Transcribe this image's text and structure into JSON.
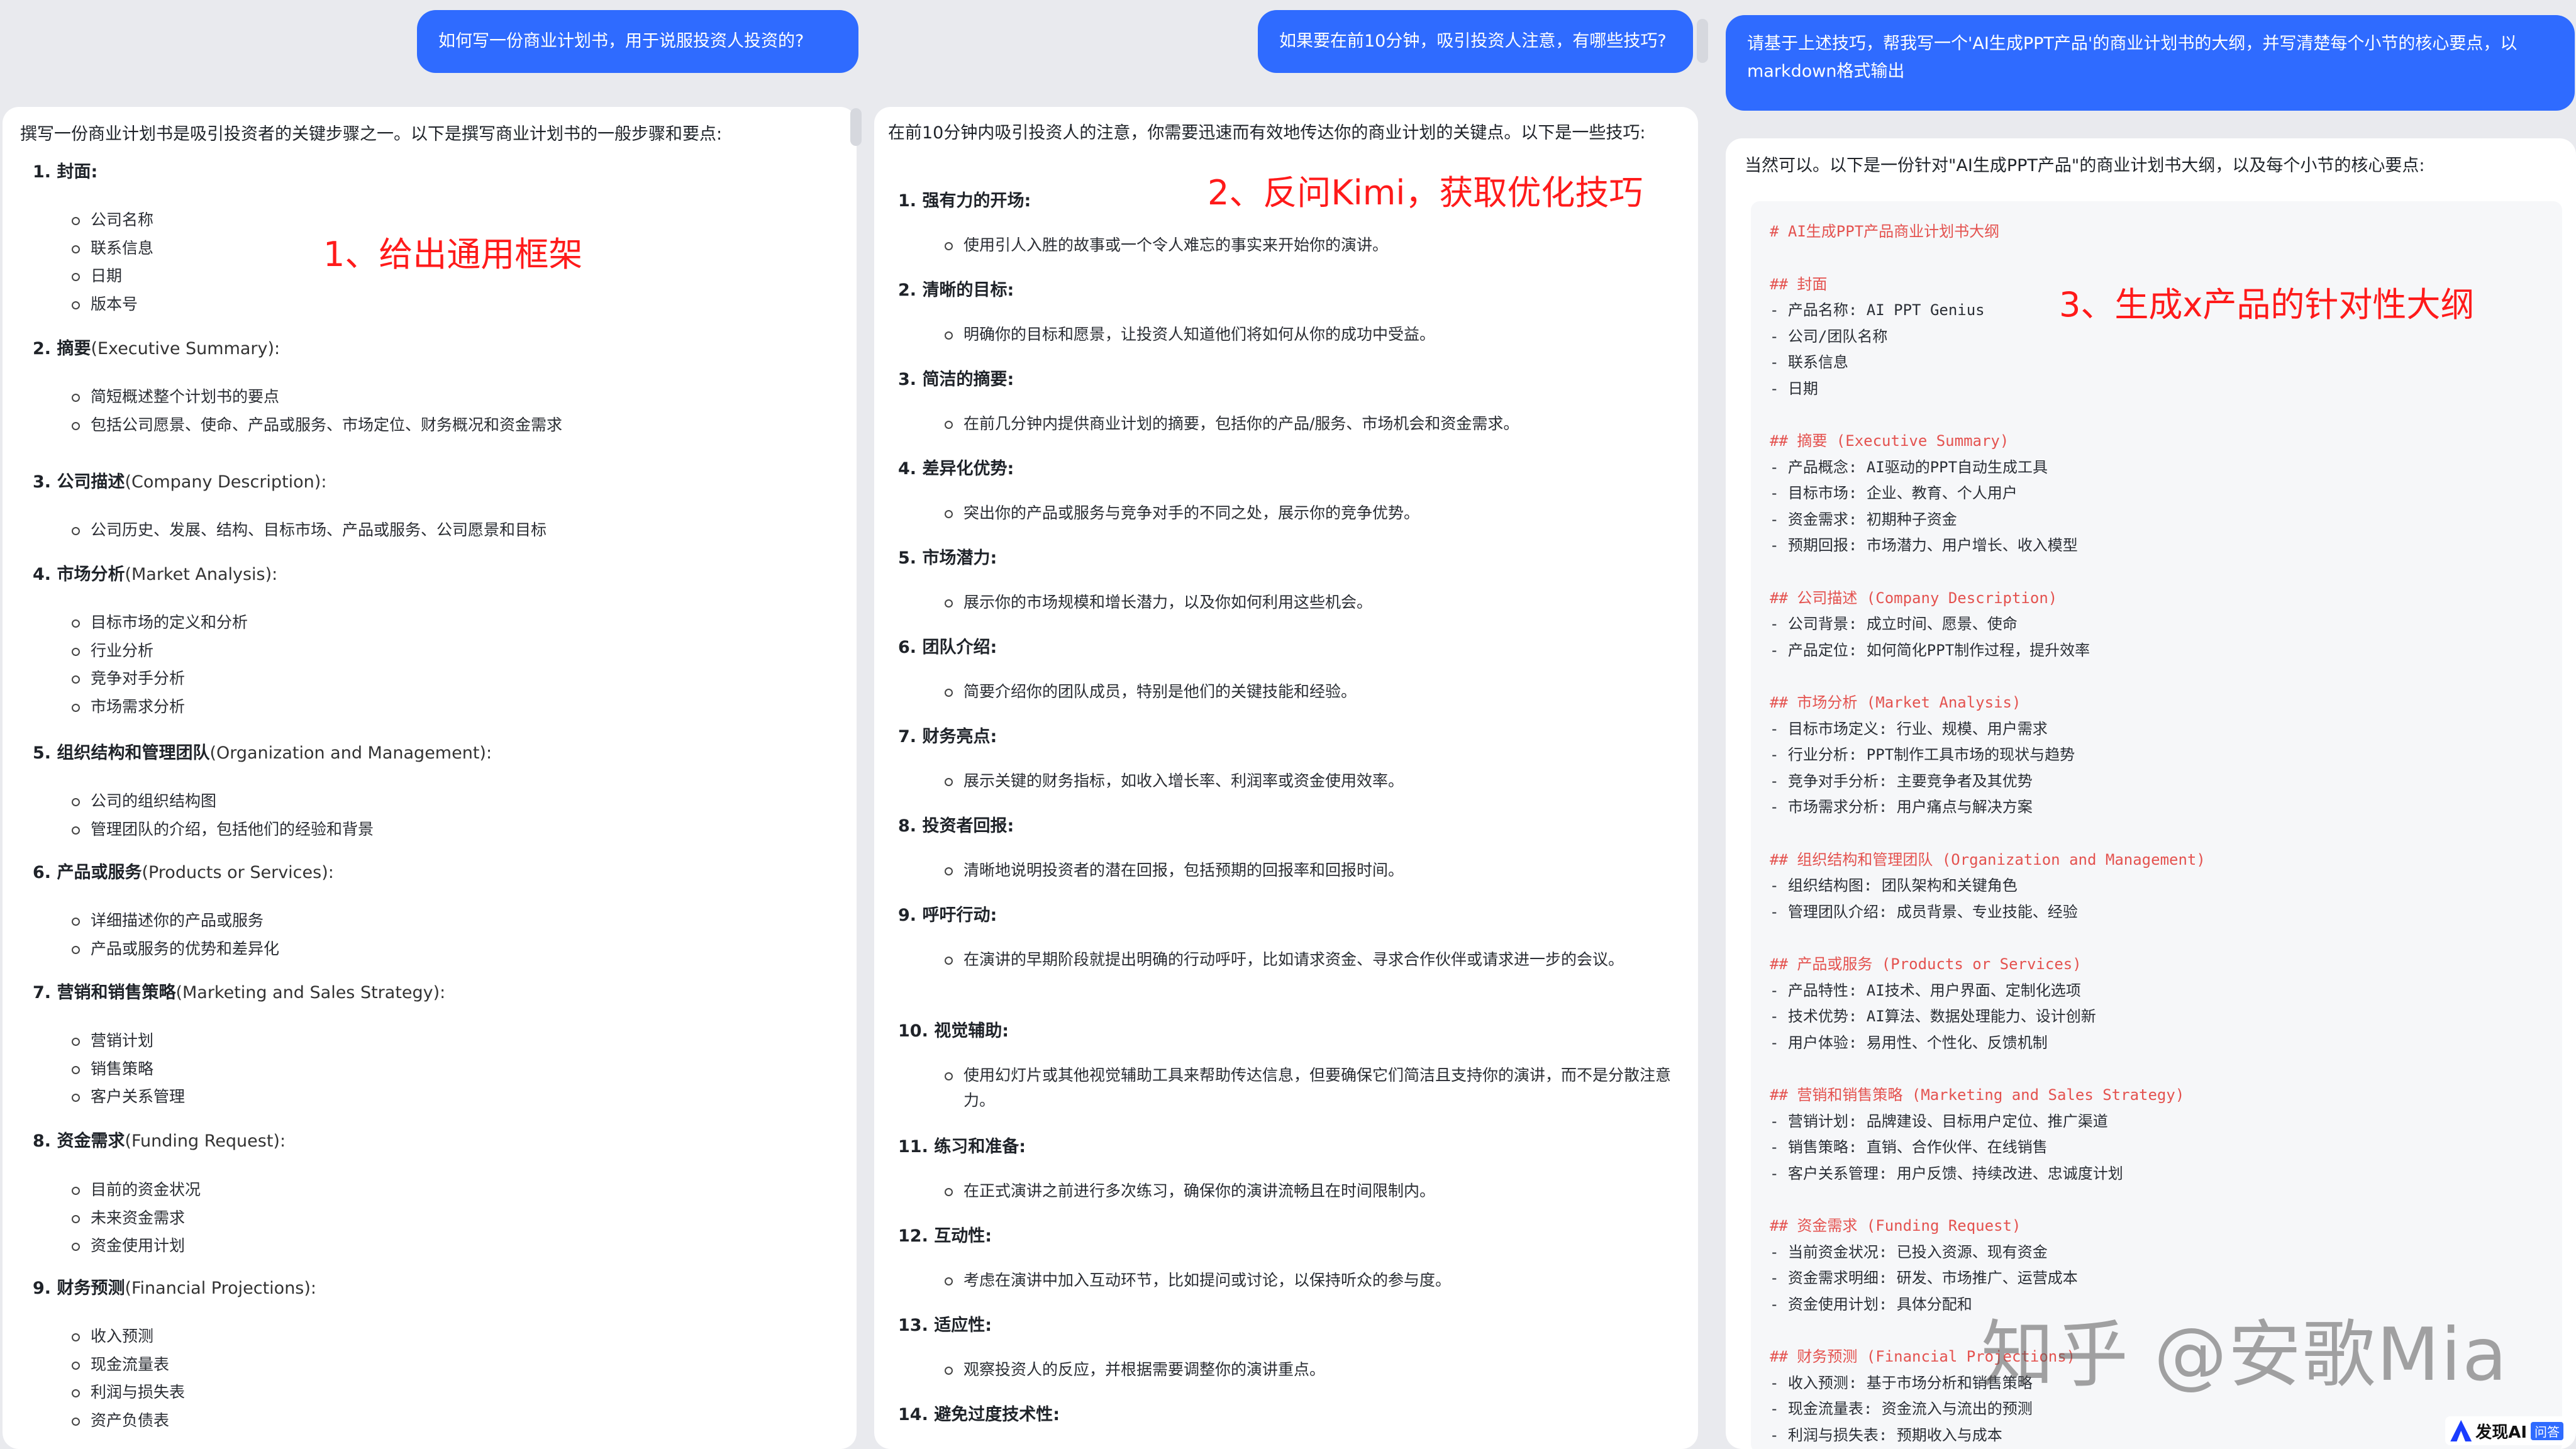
{
  "col1": {
    "question": "如何写一份商业计划书，用于说服投资人投资的?",
    "intro": "撰写一份商业计划书是吸引投资者的关键步骤之一。以下是撰写商业计划书的一般步骤和要点:",
    "annotation": "1、给出通用框架",
    "sections": [
      {
        "title": "1. 封面:",
        "en": "",
        "items": [
          "公司名称",
          "联系信息",
          "日期",
          "版本号"
        ]
      },
      {
        "title": "2. 摘要",
        "en": "(Executive Summary):",
        "items": [
          "简短概述整个计划书的要点",
          "包括公司愿景、使命、产品或服务、市场定位、财务概况和资金需求"
        ]
      },
      {
        "title": "3. 公司描述",
        "en": "(Company Description):",
        "items": [
          "公司历史、发展、结构、目标市场、产品或服务、公司愿景和目标"
        ]
      },
      {
        "title": "4. 市场分析",
        "en": "(Market Analysis):",
        "items": [
          "目标市场的定义和分析",
          "行业分析",
          "竞争对手分析",
          "市场需求分析"
        ]
      },
      {
        "title": "5. 组织结构和管理团队",
        "en": "(Organization and Management):",
        "items": [
          "公司的组织结构图",
          "管理团队的介绍，包括他们的经验和背景"
        ]
      },
      {
        "title": "6. 产品或服务",
        "en": "(Products or Services):",
        "items": [
          "详细描述你的产品或服务",
          "产品或服务的优势和差异化"
        ]
      },
      {
        "title": "7. 营销和销售策略",
        "en": "(Marketing and Sales Strategy):",
        "items": [
          "营销计划",
          "销售策略",
          "客户关系管理"
        ]
      },
      {
        "title": "8. 资金需求",
        "en": "(Funding Request):",
        "items": [
          "目前的资金状况",
          "未来资金需求",
          "资金使用计划"
        ]
      },
      {
        "title": "9. 财务预测",
        "en": "(Financial Projections):",
        "items": [
          "收入预测",
          "现金流量表",
          "利润与损失表",
          "资产负债表"
        ]
      }
    ]
  },
  "col2": {
    "question": "如果要在前10分钟，吸引投资人注意，有哪些技巧?",
    "intro": "在前10分钟内吸引投资人的注意，你需要迅速而有效地传达你的商业计划的关键点。以下是一些技巧:",
    "annotation": "2、反问Kimi，获取优化技巧",
    "sections": [
      {
        "title": "1. 强有力的开场:",
        "items": [
          "使用引人入胜的故事或一个令人难忘的事实来开始你的演讲。"
        ]
      },
      {
        "title": "2. 清晰的目标:",
        "items": [
          "明确你的目标和愿景，让投资人知道他们将如何从你的成功中受益。"
        ]
      },
      {
        "title": "3. 简洁的摘要:",
        "items": [
          "在前几分钟内提供商业计划的摘要，包括你的产品/服务、市场机会和资金需求。"
        ]
      },
      {
        "title": "4. 差异化优势:",
        "items": [
          "突出你的产品或服务与竞争对手的不同之处，展示你的竞争优势。"
        ]
      },
      {
        "title": "5. 市场潜力:",
        "items": [
          "展示你的市场规模和增长潜力，以及你如何利用这些机会。"
        ]
      },
      {
        "title": "6. 团队介绍:",
        "items": [
          "简要介绍你的团队成员，特别是他们的关键技能和经验。"
        ]
      },
      {
        "title": "7. 财务亮点:",
        "items": [
          "展示关键的财务指标，如收入增长率、利润率或资金使用效率。"
        ]
      },
      {
        "title": "8. 投资者回报:",
        "items": [
          "清晰地说明投资者的潜在回报，包括预期的回报率和回报时间。"
        ]
      },
      {
        "title": "9. 呼吁行动:",
        "items": [
          "在演讲的早期阶段就提出明确的行动呼吁，比如请求资金、寻求合作伙伴或请求进一步的会议。"
        ]
      },
      {
        "title": "10. 视觉辅助:",
        "items": [
          "使用幻灯片或其他视觉辅助工具来帮助传达信息，但要确保它们简洁且支持你的演讲，而不是分散注意力。"
        ]
      },
      {
        "title": "11. 练习和准备:",
        "items": [
          "在正式演讲之前进行多次练习，确保你的演讲流畅且在时间限制内。"
        ]
      },
      {
        "title": "12. 互动性:",
        "items": [
          "考虑在演讲中加入互动环节，比如提问或讨论，以保持听众的参与度。"
        ]
      },
      {
        "title": "13. 适应性:",
        "items": [
          "观察投资人的反应，并根据需要调整你的演讲重点。"
        ]
      },
      {
        "title": "14. 避免过度技术性:",
        "items": []
      }
    ]
  },
  "col3": {
    "question": "请基于上述技巧，帮我写一个'AI生成PPT产品'的商业计划书的大纲，并写清楚每个小节的核心要点，以markdown格式输出",
    "intro": "当然可以。以下是一份针对\"AI生成PPT产品\"的商业计划书大纲，以及每个小节的核心要点:",
    "annotation": "3、生成x产品的针对性大纲",
    "lines": [
      {
        "k": "h1",
        "t": "# AI生成PPT产品商业计划书大纲"
      },
      {
        "k": "h",
        "t": "## 封面"
      },
      {
        "k": "l",
        "t": "- 产品名称: AI PPT Genius"
      },
      {
        "k": "l",
        "t": "- 公司/团队名称"
      },
      {
        "k": "l",
        "t": "- 联系信息"
      },
      {
        "k": "l",
        "t": "- 日期"
      },
      {
        "k": "h",
        "t": "## 摘要 (Executive Summary)"
      },
      {
        "k": "l",
        "t": "- 产品概念: AI驱动的PPT自动生成工具"
      },
      {
        "k": "l",
        "t": "- 目标市场: 企业、教育、个人用户"
      },
      {
        "k": "l",
        "t": "- 资金需求: 初期种子资金"
      },
      {
        "k": "l",
        "t": "- 预期回报: 市场潜力、用户增长、收入模型"
      },
      {
        "k": "h",
        "t": "## 公司描述 (Company Description)"
      },
      {
        "k": "l",
        "t": "- 公司背景: 成立时间、愿景、使命"
      },
      {
        "k": "l",
        "t": "- 产品定位: 如何简化PPT制作过程，提升效率"
      },
      {
        "k": "h",
        "t": "## 市场分析 (Market Analysis)"
      },
      {
        "k": "l",
        "t": "- 目标市场定义: 行业、规模、用户需求"
      },
      {
        "k": "l",
        "t": "- 行业分析: PPT制作工具市场的现状与趋势"
      },
      {
        "k": "l",
        "t": "- 竞争对手分析: 主要竞争者及其优势"
      },
      {
        "k": "l",
        "t": "- 市场需求分析: 用户痛点与解决方案"
      },
      {
        "k": "h",
        "t": "## 组织结构和管理团队 (Organization and Management)"
      },
      {
        "k": "l",
        "t": "- 组织结构图: 团队架构和关键角色"
      },
      {
        "k": "l",
        "t": "- 管理团队介绍: 成员背景、专业技能、经验"
      },
      {
        "k": "h",
        "t": "## 产品或服务 (Products or Services)"
      },
      {
        "k": "l",
        "t": "- 产品特性: AI技术、用户界面、定制化选项"
      },
      {
        "k": "l",
        "t": "- 技术优势: AI算法、数据处理能力、设计创新"
      },
      {
        "k": "l",
        "t": "- 用户体验: 易用性、个性化、反馈机制"
      },
      {
        "k": "h",
        "t": "## 营销和销售策略 (Marketing and Sales Strategy)"
      },
      {
        "k": "l",
        "t": "- 营销计划: 品牌建设、目标用户定位、推广渠道"
      },
      {
        "k": "l",
        "t": "- 销售策略: 直销、合作伙伴、在线销售"
      },
      {
        "k": "l",
        "t": "- 客户关系管理: 用户反馈、持续改进、忠诚度计划"
      },
      {
        "k": "h",
        "t": "## 资金需求 (Funding Request)"
      },
      {
        "k": "l",
        "t": "- 当前资金状况: 已投入资源、现有资金"
      },
      {
        "k": "l",
        "t": "- 资金需求明细: 研发、市场推广、运营成本"
      },
      {
        "k": "l",
        "t": "- 资金使用计划: 具体分配和"
      },
      {
        "k": "h",
        "t": "## 财务预测 (Financial Projections)"
      },
      {
        "k": "l",
        "t": "- 收入预测: 基于市场分析和销售策略"
      },
      {
        "k": "l",
        "t": "- 现金流量表: 资金流入与流出的预测"
      },
      {
        "k": "l",
        "t": "- 利润与损失表: 预期收入与成本"
      }
    ]
  },
  "watermark": "知乎 @安歌Mia",
  "logo": {
    "text": "发现AI",
    "tag": "问答"
  }
}
